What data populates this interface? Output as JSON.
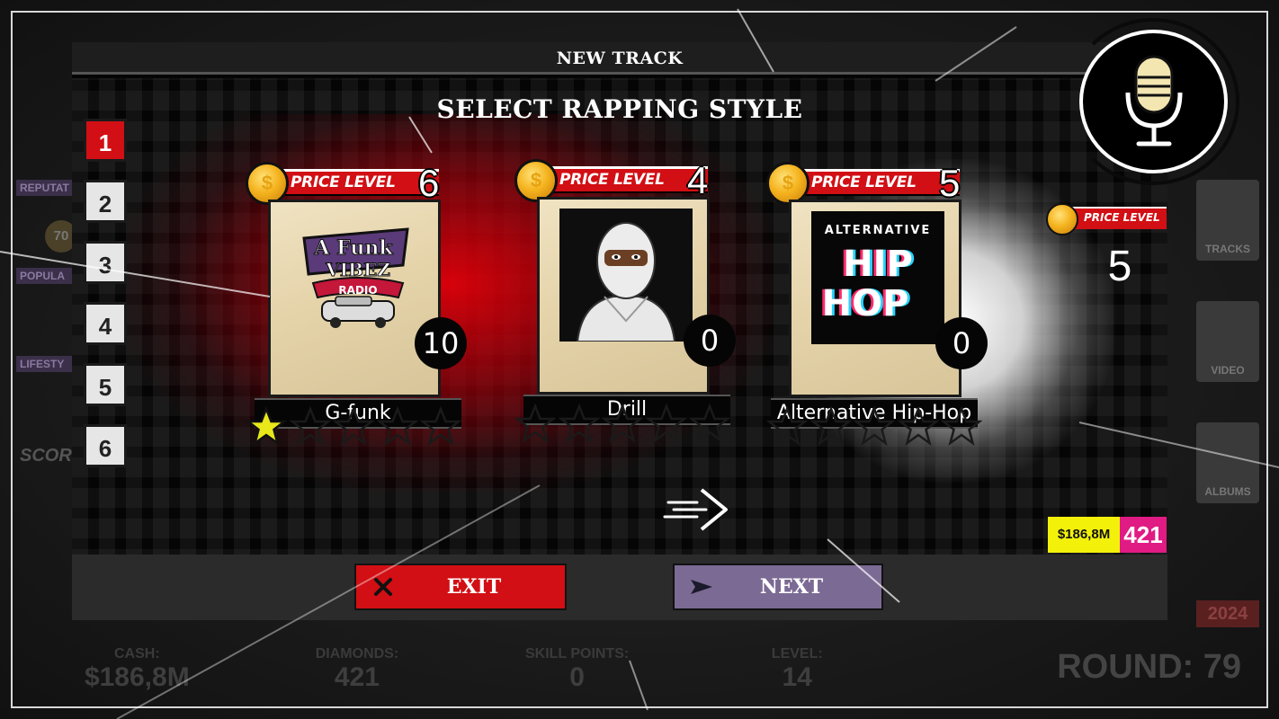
{
  "dialog": {
    "title": "NEW TRACK",
    "heading": "SELECT RAPPING STYLE"
  },
  "tabs": [
    "1",
    "2",
    "3",
    "4",
    "5",
    "6"
  ],
  "active_tab": "1",
  "cards": [
    {
      "name": "G-funk",
      "price_label": "PRICE LEVEL",
      "price_level": "6",
      "skill": "10",
      "stars_filled": 1,
      "stars_total": 5,
      "art": "afunk-vibez-radio-logo"
    },
    {
      "name": "Drill",
      "price_label": "PRICE LEVEL",
      "price_level": "4",
      "skill": "0",
      "stars_filled": 0,
      "stars_total": 5,
      "art": "masked-rapper-portrait"
    },
    {
      "name": "Alternative Hip-Hop",
      "price_label": "PRICE LEVEL",
      "price_level": "5",
      "skill": "0",
      "stars_filled": 0,
      "stars_total": 5,
      "art": "alternative-hip-hop-logo",
      "art_text_top": "ALTERNATIVE",
      "art_text_mid": "HIP",
      "art_text_bot": "HOP"
    }
  ],
  "side_info": {
    "price_label": "PRICE LEVEL",
    "price_level": "5"
  },
  "currency": {
    "cash": "$186,8M",
    "diamonds": "421"
  },
  "buttons": {
    "exit": "EXIT",
    "next": "NEXT"
  },
  "background": {
    "left_labels": [
      "REPUTAT",
      "POPULA",
      "LIFESTY",
      "SCORE"
    ],
    "left_value": "70",
    "right_buttons": [
      "TRACKS",
      "VIDEO",
      "ALBUMS"
    ],
    "year": "2024",
    "stats": [
      {
        "label": "CASH:",
        "value": "$186,8M"
      },
      {
        "label": "DIAMONDS:",
        "value": "421"
      },
      {
        "label": "SKILL POINTS:",
        "value": "0"
      },
      {
        "label": "LEVEL:",
        "value": "14"
      }
    ],
    "round": "ROUND: 79"
  },
  "colors": {
    "accent_red": "#d10f14",
    "next_purple": "#7b6a94",
    "cash_yellow": "#f3f10a",
    "diamond_pink": "#e01b84",
    "star_yellow": "#e8e81a"
  }
}
